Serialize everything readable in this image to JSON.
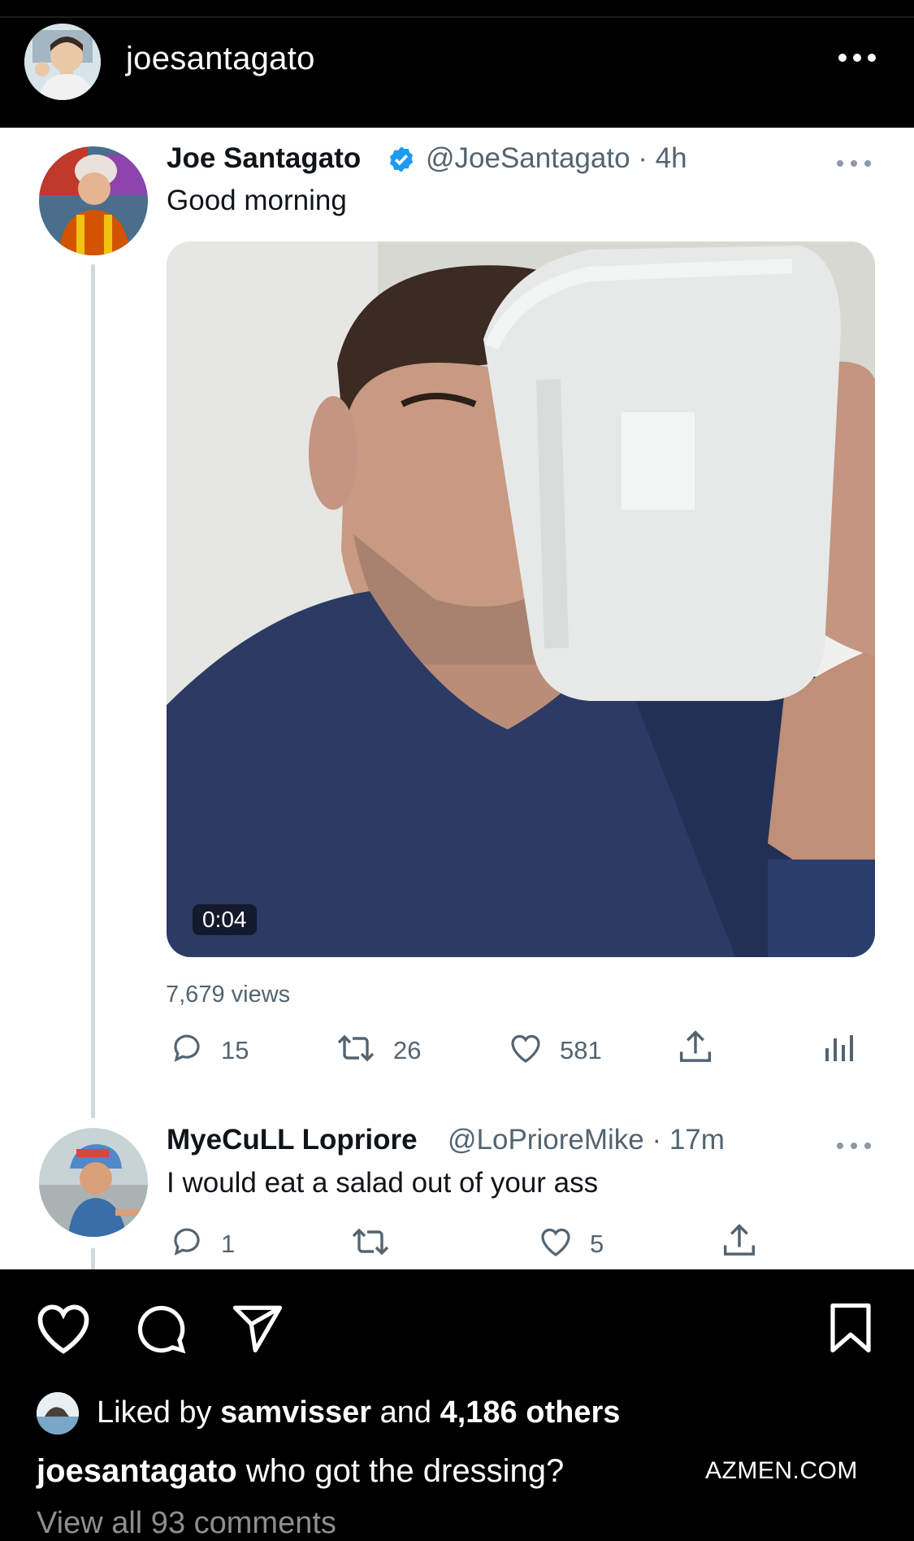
{
  "post": {
    "username": "joesantagato"
  },
  "tweet": {
    "name": "Joe Santagato",
    "handle_time": "@JoeSantagato · 4h",
    "text": "Good morning",
    "video_duration": "0:04",
    "views": "7,679 views",
    "replies": "15",
    "retweets": "26",
    "likes": "581",
    "verified_color": "#1d9bf0"
  },
  "reply": {
    "name": "MyeCuLL Lopriore",
    "handle_time": "@LoPrioreMike · 17m",
    "text": "I would eat a salad out of your ass",
    "replies": "1",
    "likes": "5"
  },
  "engagement": {
    "liked_prefix": "Liked by",
    "liked_user": "samvisser",
    "liked_and": "and",
    "liked_others": "4,186 others"
  },
  "caption": {
    "user": "joesantagato",
    "text": "who got the dressing?"
  },
  "watermark": "AZMEN.COM",
  "comments_link": "View all 93 comments",
  "icons": [
    "more-horizontal-icon",
    "verified-icon",
    "reply-icon",
    "retweet-icon",
    "like-icon",
    "share-icon",
    "analytics-icon",
    "heart-icon",
    "comment-icon",
    "send-icon",
    "bookmark-icon"
  ]
}
